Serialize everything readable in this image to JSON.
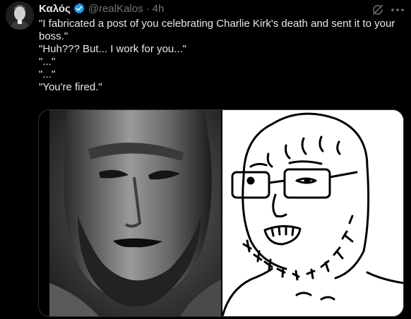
{
  "author": {
    "display_name": "Καλός",
    "handle": "@realKalos",
    "separator": "·",
    "time": "4h",
    "verified_color": "#1d9bf0"
  },
  "icons": {
    "avatar": "profile-avatar",
    "verified": "verified-badge-icon",
    "grok": "grok-icon",
    "more": "more-options-icon"
  },
  "tweet": {
    "lines": [
      "\"I fabricated a post of you celebrating Charlie Kirk's death and sent it to your boss.\"",
      "\"Huh??? But... I work for you...\"",
      "\"...\"",
      "\"...\"",
      "\"You're fired.\""
    ]
  },
  "media": {
    "left_image": "gigachad-photo",
    "right_image": "soyjak-drawing"
  }
}
